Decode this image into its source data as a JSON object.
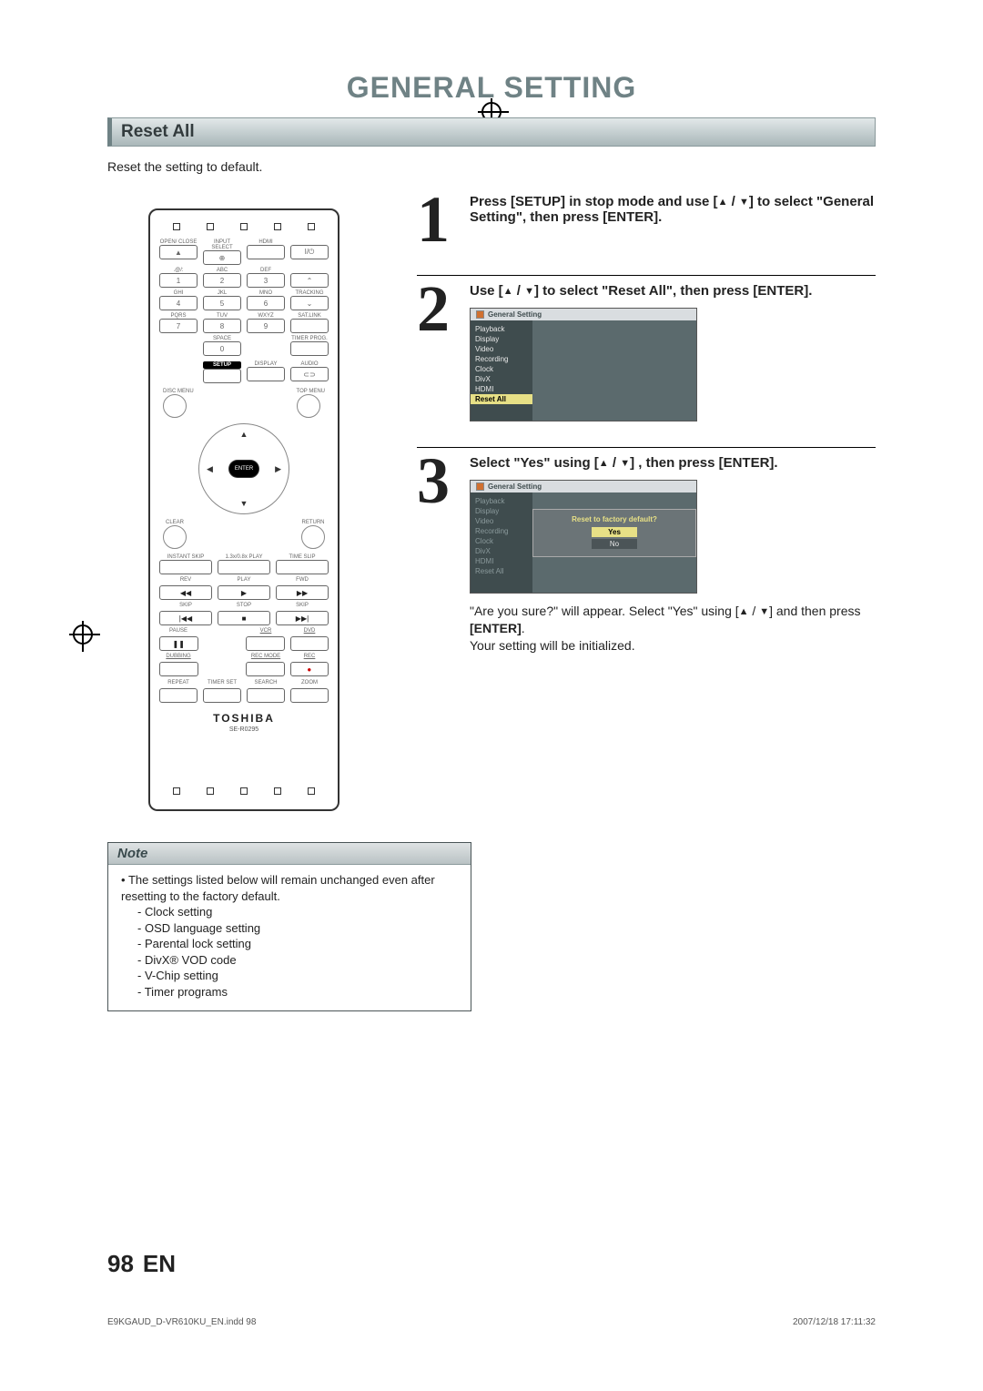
{
  "page_title": "GENERAL SETTING",
  "section": "Reset All",
  "intro": "Reset the setting to default.",
  "remote": {
    "row1_labels": [
      "OPEN/\nCLOSE",
      "INPUT\nSELECT",
      "HDMI",
      ""
    ],
    "row_keypad_labels": [
      ".@/:",
      "ABC",
      "DEF",
      "",
      "GHI",
      "JKL",
      "MNO",
      "TRACKING",
      "PQRS",
      "TUV",
      "WXYZ",
      "SAT.LINK",
      "",
      "SPACE",
      "",
      "TIMER\nPROG."
    ],
    "keypad_digits": [
      "1",
      "2",
      "3",
      "4",
      "5",
      "6",
      "7",
      "8",
      "9",
      "0"
    ],
    "setup_row": [
      "SETUP",
      "DISPLAY",
      "AUDIO"
    ],
    "disc_menu": "DISC MENU",
    "top_menu": "TOP MENU",
    "enter": "ENTER",
    "clear": "CLEAR",
    "return": "RETURN",
    "instant_skip": "INSTANT\nSKIP",
    "play_speed": "1.3x/0.8x\nPLAY",
    "time_slip": "TIME SLIP",
    "transport_labels": [
      "REV",
      "PLAY",
      "FWD",
      "SKIP",
      "STOP",
      "SKIP",
      "PAUSE",
      "",
      "VCR",
      "DVD",
      "DUBBING",
      "",
      "REC MODE",
      "REC",
      "REPEAT",
      "TIMER SET",
      "SEARCH",
      "ZOOM"
    ],
    "brand": "TOSHIBA",
    "model": "SE-R0295"
  },
  "steps": [
    {
      "num": "1",
      "text_parts": [
        "Press [SETUP] in stop mode and use [",
        "▲",
        " / ",
        "▼",
        "] to select \"General Setting\", then press [ENTER]."
      ]
    },
    {
      "num": "2",
      "text_parts": [
        "Use [",
        "▲",
        " / ",
        "▼",
        "] to select \"Reset All\", then press [ENTER]."
      ],
      "osd": {
        "title": "General Setting",
        "menu": [
          "Playback",
          "Display",
          "Video",
          "Recording",
          "Clock",
          "DivX",
          "HDMI",
          "Reset All"
        ],
        "selected": "Reset All"
      }
    },
    {
      "num": "3",
      "text_parts": [
        "Select \"Yes\" using [",
        "▲",
        " / ",
        "▼",
        "] , then press [ENTER]."
      ],
      "osd": {
        "title": "General Setting",
        "menu": [
          "Playback",
          "Display",
          "Video",
          "Recording",
          "Clock",
          "DivX",
          "HDMI",
          "Reset All"
        ],
        "dialog": {
          "question": "Reset to factory default?",
          "options": [
            "Yes",
            "No"
          ],
          "selected": "Yes"
        }
      },
      "tail_parts": [
        "\"Are you sure?\" will appear.  Select \"Yes\" using [",
        "▲",
        " / ",
        "▼",
        "] and then press ",
        "[ENTER]",
        ".",
        " Your setting will be initialized."
      ]
    }
  ],
  "note": {
    "heading": "Note",
    "lead": "The settings listed below will remain unchanged even after resetting to the factory default.",
    "items": [
      "Clock setting",
      "OSD language setting",
      "Parental lock setting",
      "DivX® VOD code",
      "V-Chip setting",
      "Timer programs"
    ]
  },
  "page_number": "98",
  "page_lang": "EN",
  "footer_left": "E9KGAUD_D-VR610KU_EN.indd   98",
  "footer_right": "2007/12/18   17:11:32"
}
